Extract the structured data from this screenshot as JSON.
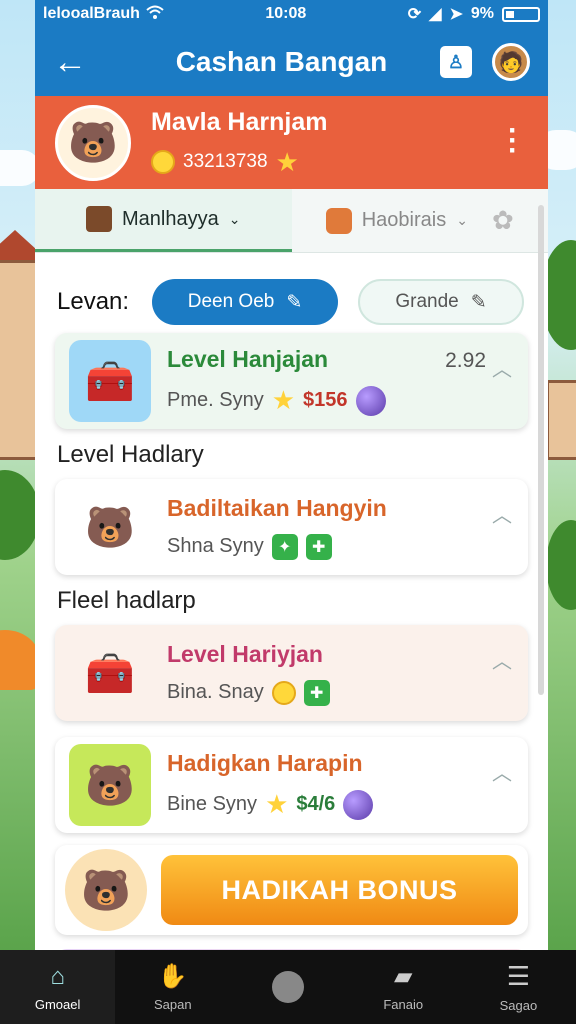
{
  "status_bar": {
    "carrier": "lelooalBrauh",
    "time": "10:08",
    "battery_text": "9%"
  },
  "app_bar": {
    "back_icon": "back-arrow-icon",
    "title": "Cashan Bangan",
    "action_icon": "notification-icon",
    "avatar_icon": "user-avatar-icon"
  },
  "profile": {
    "name": "Mavla Harnjam",
    "score": "33213738",
    "coin_icon": "coin-icon",
    "star_icon": "star-icon",
    "menu_icon": "more-vertical-icon"
  },
  "tabs": [
    {
      "label": "Manlhayya",
      "icon": "box-icon",
      "active": true
    },
    {
      "label": "Haobirais",
      "icon": "leaf-icon",
      "active": false
    }
  ],
  "filter": {
    "label": "Levan:",
    "active_option": "Deen Oeb",
    "other_option": "Grande"
  },
  "cards": [
    {
      "title": "Level Hanjajan",
      "subtitle": "Pme. Syny",
      "price": "$156",
      "count": "2.92",
      "title_color": "#2b8a3a",
      "bg": "#eef7f0",
      "thumb_bg": "#9fd8f7"
    },
    {
      "title": "Badiltaikan Hangyin",
      "subtitle": "Shna Syny",
      "title_color": "#d8652a",
      "bg": "#ffffff",
      "thumb_bg": "#ffffff"
    },
    {
      "title": "Level Hariyjan",
      "subtitle": "Bina. Snay",
      "title_color": "#c13a6a",
      "bg": "#fbf1eb",
      "thumb_bg": "#fbf1eb"
    },
    {
      "title": "Hadigkan Harapin",
      "subtitle": "Bine Syny",
      "price": "$4/6",
      "title_color": "#d8652a",
      "bg": "#ffffff",
      "thumb_bg": "#c6e85a"
    }
  ],
  "sections": {
    "level": "Level Hadlary",
    "fleel": "Fleel hadlarp"
  },
  "bonus": {
    "label": "HADIKAH BONUS"
  },
  "bottom_nav": [
    {
      "label": "Gmoael",
      "icon": "home-icon",
      "active": true
    },
    {
      "label": "Sapan",
      "icon": "hand-icon",
      "active": false
    },
    {
      "label": "",
      "icon": "circle-icon",
      "active": false
    },
    {
      "label": "Fanaio",
      "icon": "chat-icon",
      "active": false
    },
    {
      "label": "Sagao",
      "icon": "menu-icon",
      "active": false
    }
  ]
}
